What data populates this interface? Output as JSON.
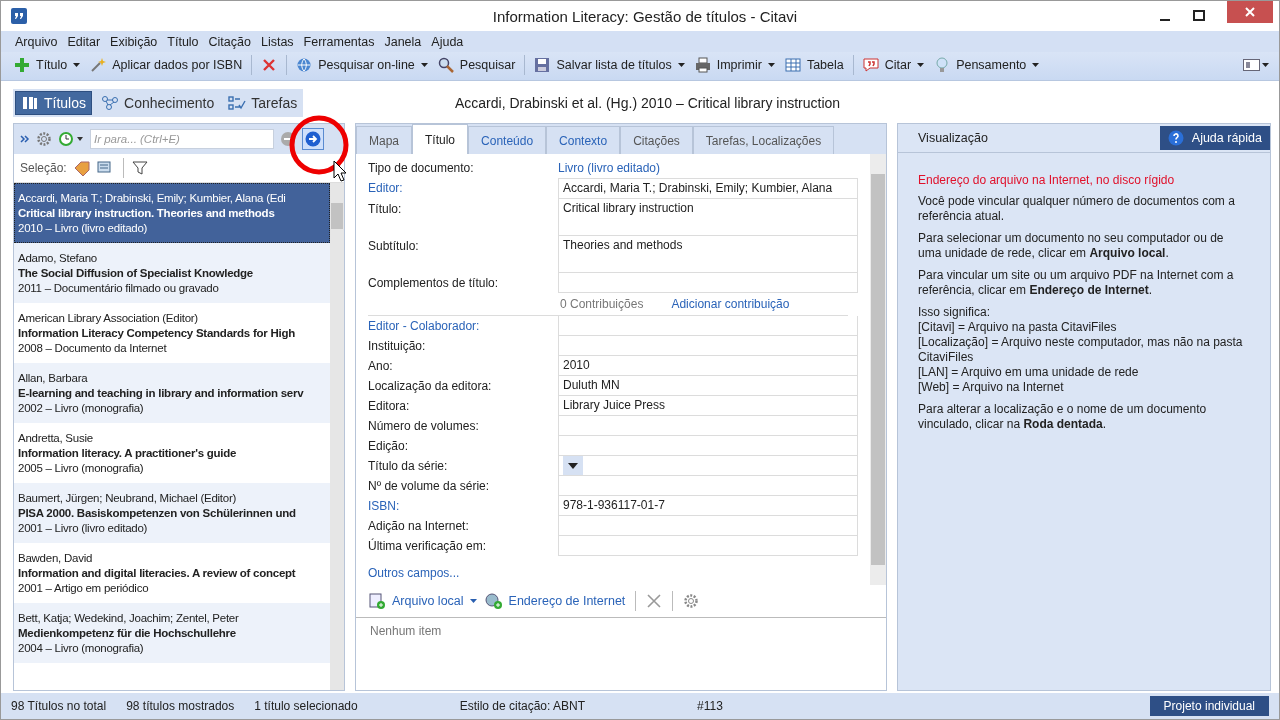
{
  "window": {
    "title": "Information Literacy: Gestão de títulos - Citavi"
  },
  "menu": [
    "Arquivo",
    "Editar",
    "Exibição",
    "Título",
    "Citação",
    "Listas",
    "Ferramentas",
    "Janela",
    "Ajuda"
  ],
  "toolbar": [
    {
      "label": "Título",
      "dropdown": true
    },
    {
      "label": "Aplicar dados por ISBN",
      "dropdown": false
    },
    {
      "dropdown": false,
      "kind": "delete"
    },
    {
      "label": "Pesquisar on-line",
      "dropdown": true
    },
    {
      "label": "Pesquisar",
      "dropdown": false
    },
    {
      "label": "Salvar lista de títulos",
      "dropdown": true
    },
    {
      "label": "Imprimir",
      "dropdown": true
    },
    {
      "label": "Tabela",
      "dropdown": false
    },
    {
      "label": "Citar",
      "dropdown": true
    },
    {
      "label": "Pensamento",
      "dropdown": true
    }
  ],
  "nav_tabs": [
    {
      "label": "Títulos",
      "selected": true
    },
    {
      "label": "Conhecimento",
      "selected": false
    },
    {
      "label": "Tarefas",
      "selected": false
    }
  ],
  "record_header": "Accardi, Drabinski et al. (Hg.) 2010 – Critical library instruction",
  "search": {
    "placeholder": "Ir para... (Ctrl+E)"
  },
  "selection_label": "Seleção:",
  "references": [
    {
      "authors": "Accardi, Maria T.; Drabinski, Emily; Kumbier, Alana (Edi",
      "title": "Critical library instruction. Theories and methods",
      "meta": "2010 – Livro (livro editado)",
      "selected": true
    },
    {
      "authors": "Adamo, Stefano",
      "title": "The Social Diffusion of Specialist Knowledge",
      "meta": "2011 – Documentário filmado ou gravado",
      "selected": false
    },
    {
      "authors": "American Library Association (Editor)",
      "title": "Information Literacy Competency Standards for High",
      "meta": "2008 – Documento da Internet",
      "selected": false
    },
    {
      "authors": "Allan, Barbara",
      "title": "E-learning and teaching in library and information serv",
      "meta": "2002 – Livro (monografia)",
      "selected": false
    },
    {
      "authors": "Andretta, Susie",
      "title": "Information literacy. A practitioner's guide",
      "meta": "2005 – Livro (monografia)",
      "selected": false
    },
    {
      "authors": "Baumert, Jürgen; Neubrand, Michael (Editor)",
      "title": "PISA 2000. Basiskompetenzen von Schülerinnen und",
      "meta": "2001 – Livro (livro editado)",
      "selected": false
    },
    {
      "authors": "Bawden, David",
      "title": "Information and digital literacies. A review of concept",
      "meta": "2001 – Artigo em periódico",
      "selected": false
    },
    {
      "authors": "Bett, Katja; Wedekind, Joachim; Zentel, Peter",
      "title": "Medienkompetenz für die Hochschullehre",
      "meta": "2004 – Livro (monografia)",
      "selected": false
    }
  ],
  "editor_tabs": [
    {
      "label": "Mapa",
      "selected": false
    },
    {
      "label": "Título",
      "selected": true
    },
    {
      "label": "Conteúdo",
      "selected": false
    },
    {
      "label": "Contexto",
      "selected": false
    },
    {
      "label": "Citações",
      "selected": false
    },
    {
      "label": "Tarefas, Localizações",
      "selected": false
    }
  ],
  "document_type": {
    "label": "Tipo de documento:",
    "value": "Livro (livro editado)"
  },
  "fields_top": [
    {
      "label": "Editor:",
      "value": "Accardi, Maria T.; Drabinski, Emily; Kumbier, Alana",
      "link": true,
      "kind": "text"
    },
    {
      "label": "Título:",
      "value": "Critical library instruction",
      "link": false,
      "kind": "multiline"
    },
    {
      "label": "Subtítulo:",
      "value": "Theories and methods",
      "link": false,
      "kind": "multiline"
    },
    {
      "label": "Complementos de título:",
      "link": false,
      "kind": "text"
    }
  ],
  "contributions": {
    "count": "0 Contribuições",
    "add": "Adicionar contribuição"
  },
  "fields": [
    {
      "label": "Editor - Colaborador:",
      "link": true,
      "kind": "text"
    },
    {
      "label": "Instituição:",
      "link": false,
      "kind": "text"
    },
    {
      "label": "Ano:",
      "value": "2010",
      "link": false,
      "kind": "text"
    },
    {
      "label": "Localização da editora:",
      "value": "Duluth MN",
      "link": false,
      "kind": "text"
    },
    {
      "label": "Editora:",
      "value": "Library Juice Press",
      "link": false,
      "kind": "text"
    },
    {
      "label": "Número de volumes:",
      "link": false,
      "kind": "text"
    },
    {
      "label": "Edição:",
      "link": false,
      "kind": "text"
    },
    {
      "label": "Título da série:",
      "link": false,
      "kind": "dropdown"
    },
    {
      "label": "Nº de volume da série:",
      "link": false,
      "kind": "text"
    },
    {
      "label": "ISBN:",
      "value": "978-1-936117-01-7",
      "link": true,
      "kind": "text"
    },
    {
      "label": "Adição na Internet:",
      "link": false,
      "kind": "text"
    },
    {
      "label": "Última verificação em:",
      "link": false,
      "kind": "text"
    }
  ],
  "more_fields": "Outros campos...",
  "attachments": {
    "buttons": [
      {
        "label": "Arquivo local",
        "dropdown": true
      },
      {
        "label": "Endereço de Internet",
        "dropdown": false
      }
    ],
    "empty": "Nenhum item"
  },
  "preview": {
    "tab": "Visualização",
    "help_button": "Ajuda rápida",
    "heading": "Endereço do arquivo na Internet, no disco rígido",
    "paragraphs": [
      {
        "lines": [
          "Você pode vincular qualquer número de documentos com a referência atual."
        ]
      },
      {
        "lines": [
          "Para selecionar um documento no seu computador ou de uma unidade de rede, clicar em **Arquivo local**."
        ]
      },
      {
        "lines": [
          "Para vincular um site ou um arquivo PDF na Internet com a referência, clicar em **Endereço de Internet**."
        ]
      },
      {
        "lines": [
          "Isso significa:",
          "[Citavi] = Arquivo na pasta CitaviFiles",
          "[Localização] = Arquivo neste computador, mas não na pasta CitaviFiles",
          "[LAN] = Arquivo em uma unidade de rede",
          "[Web] = Arquivo na Internet"
        ]
      },
      {
        "lines": [
          "Para alterar a localização e o nome de um documento vinculado, clicar na **Roda dentada**."
        ]
      }
    ]
  },
  "status_bar": {
    "items": [
      "98 Títulos no total",
      "98 títulos mostrados",
      "1 título selecionado",
      "Estilo de citação: ABNT",
      "#113"
    ],
    "project": "Projeto individual"
  }
}
